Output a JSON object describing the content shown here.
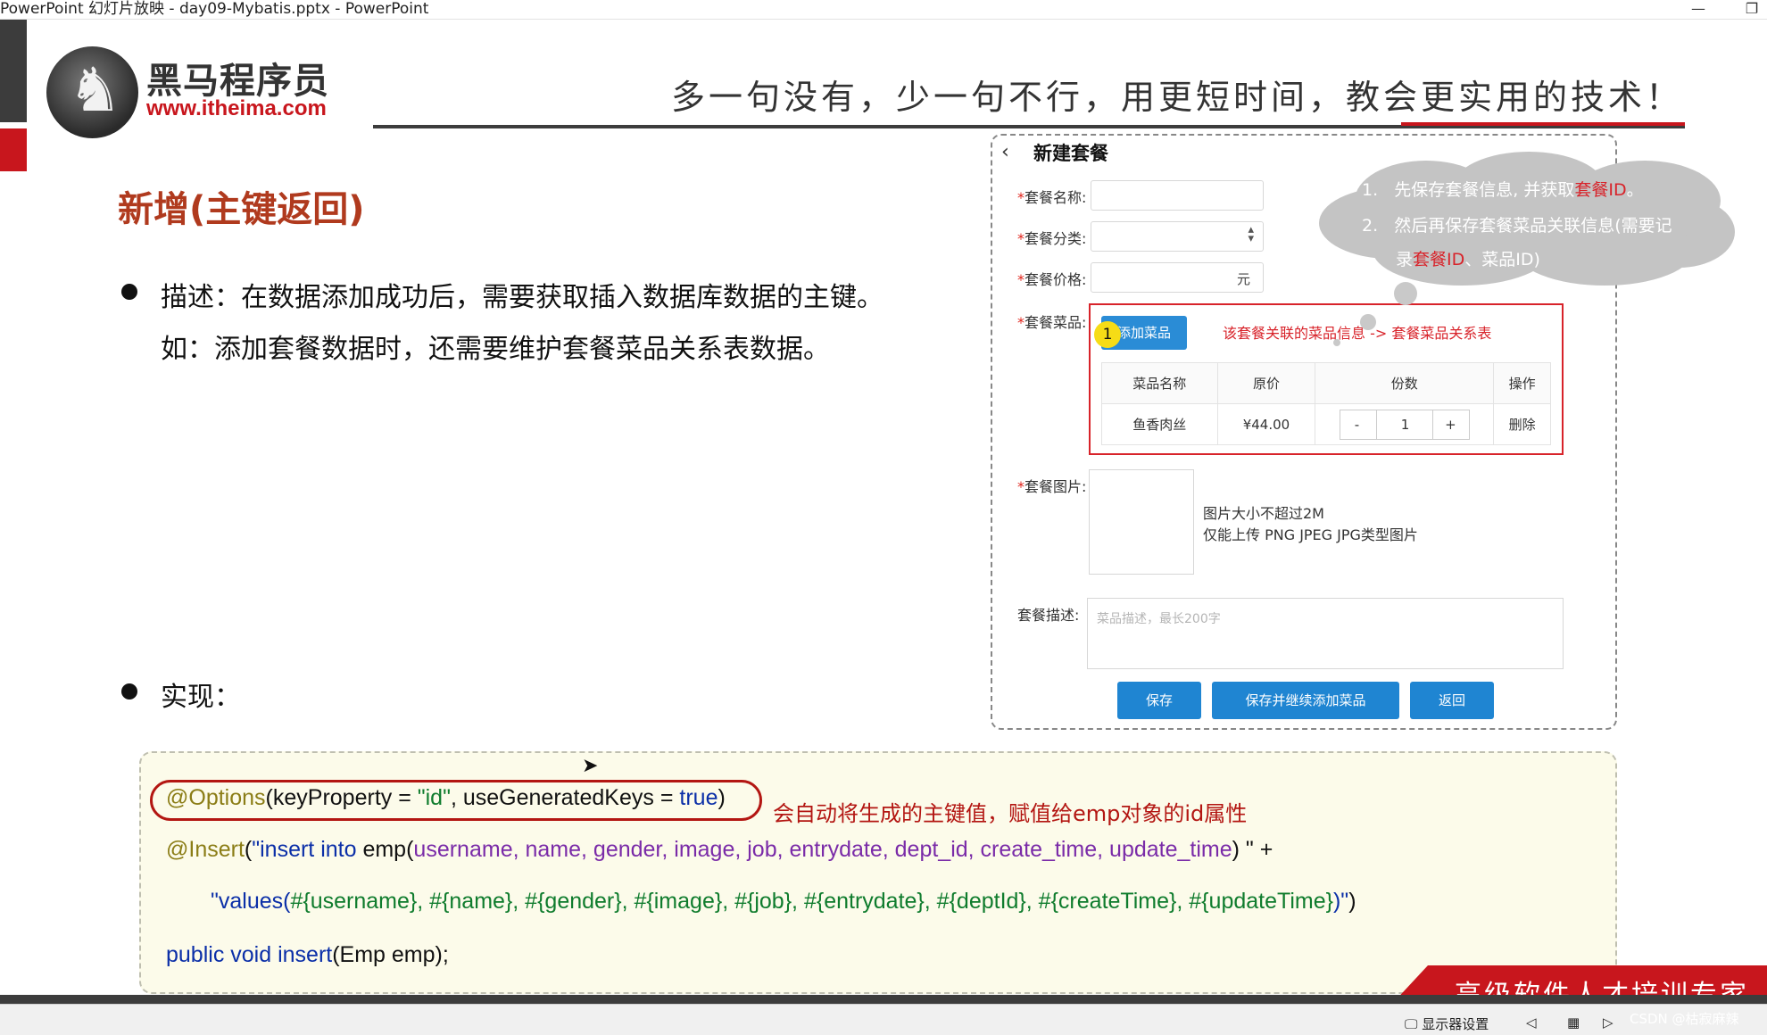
{
  "window": {
    "title": "PowerPoint 幻灯片放映  -  day09-Mybatis.pptx - PowerPoint",
    "minimize_icon": "minimize-icon",
    "restore_icon": "restore-icon"
  },
  "header": {
    "logo_cn": "黑马程序员",
    "logo_url": "www.itheima.com",
    "slogan": "多一句没有，少一句不行，用更短时间，教会更实用的技术！"
  },
  "slide": {
    "title": "新增(主键返回)",
    "desc_line1": "描述：在数据添加成功后，需要获取插入数据库数据的主键。",
    "desc_line2": "如：添加套餐数据时，还需要维护套餐菜品关系表数据。",
    "impl_label": "实现："
  },
  "form": {
    "back": "‹",
    "title": "新建套餐",
    "req_mark": "*",
    "name_label": "套餐名称:",
    "category_label": "套餐分类:",
    "price_label": "套餐价格:",
    "price_unit": "元",
    "dishes_label": "套餐菜品:",
    "add_dish_button": "添加菜品",
    "step_badge": "1",
    "dish_note": "该套餐关联的菜品信息  ->  套餐菜品关系表",
    "table": {
      "headers": [
        "菜品名称",
        "原价",
        "份数",
        "操作"
      ],
      "row": {
        "name": "鱼香肉丝",
        "price": "¥44.00",
        "minus": "-",
        "qty": "1",
        "plus": "+",
        "action": "删除"
      }
    },
    "image_label": "套餐图片:",
    "image_note1": "图片大小不超过2M",
    "image_note2": "仅能上传 PNG JPEG JPG类型图片",
    "desc_label": "套餐描述:",
    "desc_placeholder": "菜品描述，最长200字",
    "save_button": "保存",
    "save_continue_button": "保存并继续添加菜品",
    "return_button": "返回"
  },
  "cloud": {
    "item1_num": "1.",
    "item1_pre": "先保存套餐信息, 并获取",
    "item1_hl": "套餐ID",
    "item1_post": "。",
    "item2_num": "2.",
    "item2_line1": "然后再保存套餐菜品关联信息(需要记",
    "item2_pre": "录",
    "item2_hl": "套餐ID",
    "item2_post": "、菜品ID)"
  },
  "code": {
    "l1_ann": "@Options",
    "l1_a": "(keyProperty = ",
    "l1_b": "\"id\"",
    "l1_c": ", useGeneratedKeys = ",
    "l1_d": "true",
    "l1_e": ")",
    "note": "会自动将生成的主键值，赋值给emp对象的id属性",
    "l2_ann": "@Insert",
    "l2_a": "(",
    "l2_b": "\"insert into ",
    "l2_c": "emp(",
    "l2_d": "username, name, gender, image, job, entrydate, dept_id, create_time, update_time",
    "l2_e": ") \"",
    "l2_f": " +",
    "l3_a": "\"values(",
    "l3_b": "#{username}, #{name}, #{gender}, #{image}, #{job}, #{entrydate}, #{deptId}, #{createTime}, #{updateTime}",
    "l3_c": ")\"",
    "l3_d": ")",
    "l4_a": "public void ",
    "l4_b": "insert",
    "l4_c": "(Emp emp);"
  },
  "footer": {
    "slogan": "高级软件人才培训专家"
  },
  "taskbar": {
    "display_settings": "显示器设置",
    "watermark": "CSDN @枯寂麻辣"
  }
}
